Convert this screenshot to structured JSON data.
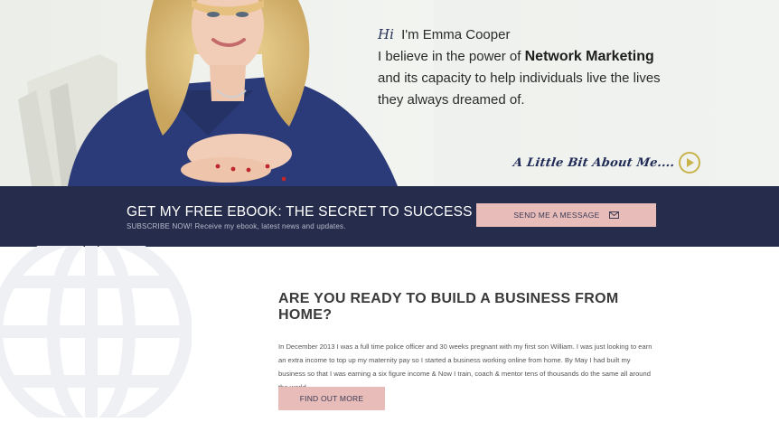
{
  "hero": {
    "greeting": "Hi",
    "name_line": "I'm Emma Cooper",
    "belief_prefix": "I believe in the power of ",
    "belief_bold": "Network Marketing",
    "belief_line2": "and its capacity to help individuals live the lives",
    "belief_line3": "they always dreamed of.",
    "about_link": "A Little Bit About Me....",
    "about_icon": "play-circle-icon",
    "accent_color": "#c8b34a"
  },
  "ebook_band": {
    "title": "GET MY FREE EBOOK: THE SECRET TO SUCCESS",
    "subtitle": "SUBSCRIBE NOW! Receive my ebook, latest news and updates.",
    "button_label": "SEND ME A MESSAGE",
    "button_icon": "envelope-icon",
    "background_color": "#252c4c",
    "button_color": "#e7bcb9"
  },
  "main": {
    "title": "ARE YOU READY TO BUILD A BUSINESS FROM HOME?",
    "body": "In December 2013 I was a full time police officer and 30 weeks pregnant with my first son William. I was just looking to earn an extra income to top up my maternity pay so I started a business working online from home. By May I had built my business so that I was earning a six figure income & Now I train, coach & mentor tens of thousands do the same all around the world.",
    "button_label": "FIND OUT MORE",
    "decor_icon": "globe-icon"
  }
}
